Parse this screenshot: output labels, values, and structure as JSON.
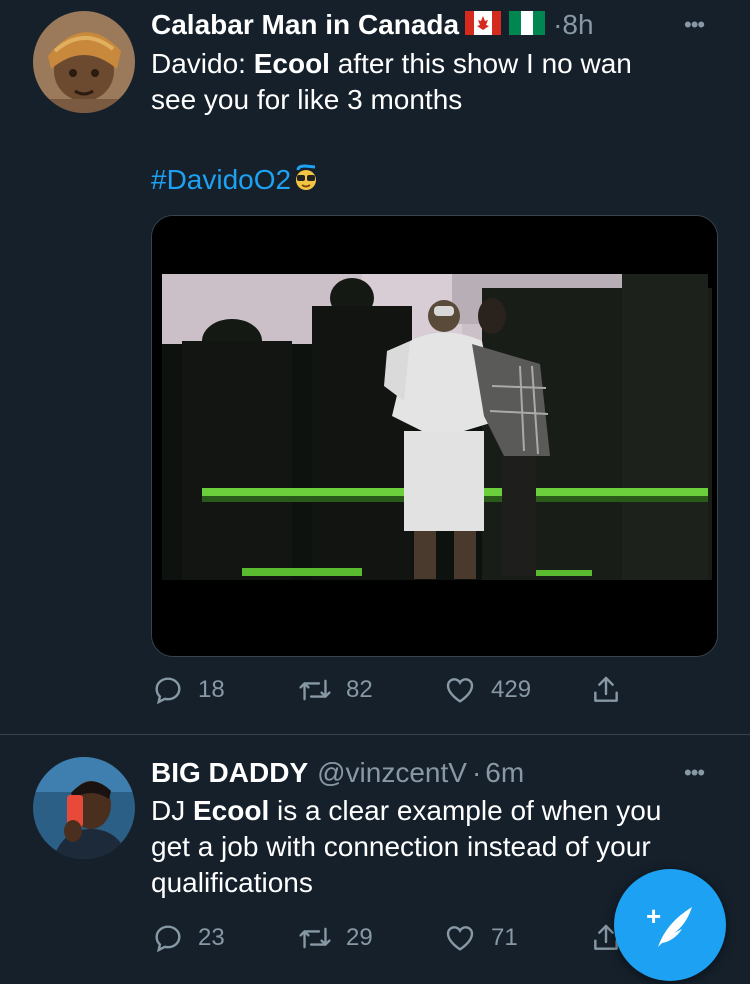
{
  "tweet1": {
    "author_name": "Calabar Man in Canada",
    "flags": [
      "canada-flag",
      "nigeria-flag"
    ],
    "separator": "·",
    "time": "8h",
    "more": "•••",
    "text_line1_pre": "Davido: ",
    "text_line1_bold": "Ecool",
    "text_line1_post": " after this show I no wan",
    "text_line2": "see you for like 3 months",
    "hashtag": "#DavidoO2",
    "hashtag_emoji": "sunglasses-emoji",
    "media": "video",
    "actions": {
      "replies": "18",
      "retweets": "82",
      "likes": "429"
    }
  },
  "tweet2": {
    "author_name": "BIG DADDY",
    "handle": "@vinzcentV",
    "separator": "·",
    "time": "6m",
    "more": "•••",
    "text_line1_pre": "DJ ",
    "text_line1_bold": "Ecool",
    "text_line1_post": " is a clear example of when you",
    "text_line2": "get a job with connection instead of your",
    "text_line3": "qualifications",
    "actions": {
      "replies": "23",
      "retweets": "29",
      "likes": "71"
    }
  },
  "compose_button": {
    "icon": "compose-tweet-icon",
    "plus": "+"
  },
  "colors": {
    "background": "#15202b",
    "accent": "#1da1f2",
    "muted": "#8899a6",
    "divider": "#38444d"
  }
}
